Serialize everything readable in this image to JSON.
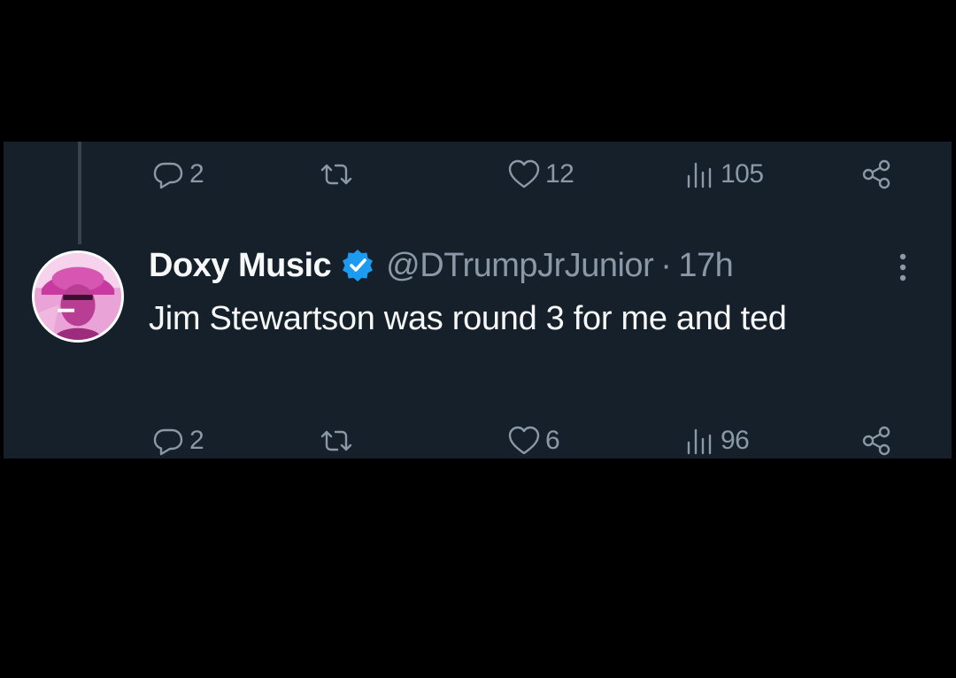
{
  "previous_tweet": {
    "actions": {
      "reply_count": "2",
      "retweet_count": "",
      "like_count": "12",
      "view_count": "105"
    }
  },
  "tweet": {
    "display_name": "Doxy Music",
    "verified": true,
    "handle": "@DTrumpJrJunior",
    "separator": "·",
    "time": "17h",
    "text": "Jim Stewartson was round 3 for me and ted",
    "actions": {
      "reply_count": "2",
      "retweet_count": "",
      "like_count": "6",
      "view_count": "96"
    }
  },
  "colors": {
    "background": "#15202b",
    "outer": "#000000",
    "text_primary": "#f7f9f9",
    "text_secondary": "#8b98a5",
    "verified": "#1d9bf0",
    "avatar_tint": "#e05ab8"
  },
  "icons": {
    "reply": "reply-icon",
    "retweet": "retweet-icon",
    "like": "heart-icon",
    "views": "views-icon",
    "share": "share-icon",
    "verified": "verified-badge-icon",
    "more": "more-options-icon"
  }
}
